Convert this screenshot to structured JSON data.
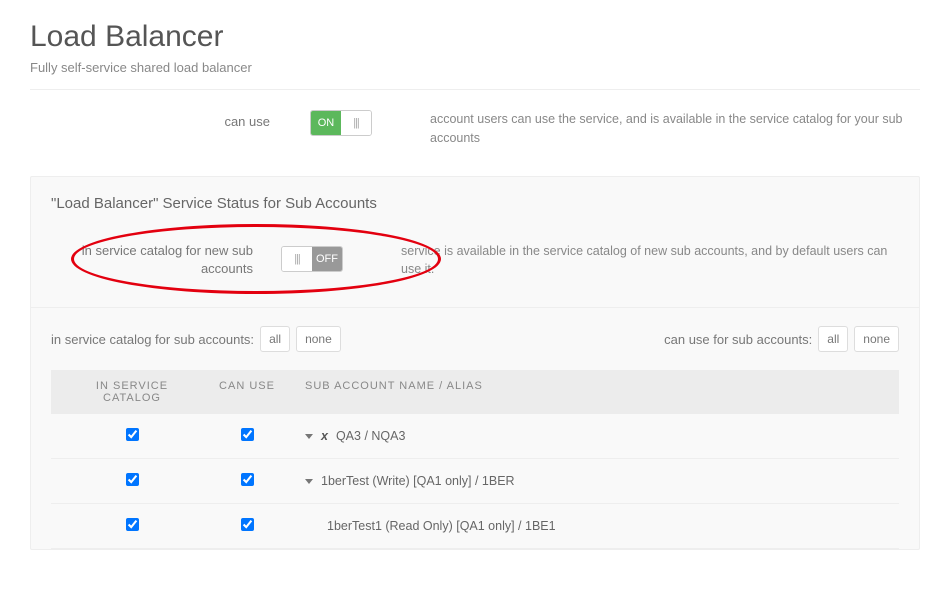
{
  "page_title": "Load Balancer",
  "page_subtitle": "Fully self-service shared load balancer",
  "can_use": {
    "label": "can use",
    "state": "on",
    "on_text": "ON",
    "off_glyph": "|||",
    "description": "account users can use the service, and is available in the service catalog for your sub accounts"
  },
  "panel": {
    "title": "\"Load Balancer\" Service Status for Sub Accounts",
    "in_service_new": {
      "label": "in service catalog for new sub accounts",
      "state": "off",
      "on_glyph": "|||",
      "off_text": "OFF",
      "description": "service is available in the service catalog of new sub accounts, and by default users can use it."
    },
    "filters": {
      "left_label": "in service catalog for sub accounts:",
      "right_label": "can use for sub accounts:",
      "all_btn": "all",
      "none_btn": "none"
    },
    "table": {
      "head_in_service": "IN SERVICE CATALOG",
      "head_can_use": "CAN USE",
      "head_name": "SUB ACCOUNT NAME / ALIAS",
      "rows": [
        {
          "in_service": true,
          "can_use": true,
          "has_caret": true,
          "has_x": true,
          "indent": 0,
          "name": "QA3 / NQA3"
        },
        {
          "in_service": true,
          "can_use": true,
          "has_caret": true,
          "has_x": false,
          "indent": 0,
          "name": "1berTest (Write) [QA1 only] / 1BER"
        },
        {
          "in_service": true,
          "can_use": true,
          "has_caret": false,
          "has_x": false,
          "indent": 1,
          "name": "1berTest1 (Read Only) [QA1 only] / 1BE1"
        }
      ]
    }
  }
}
